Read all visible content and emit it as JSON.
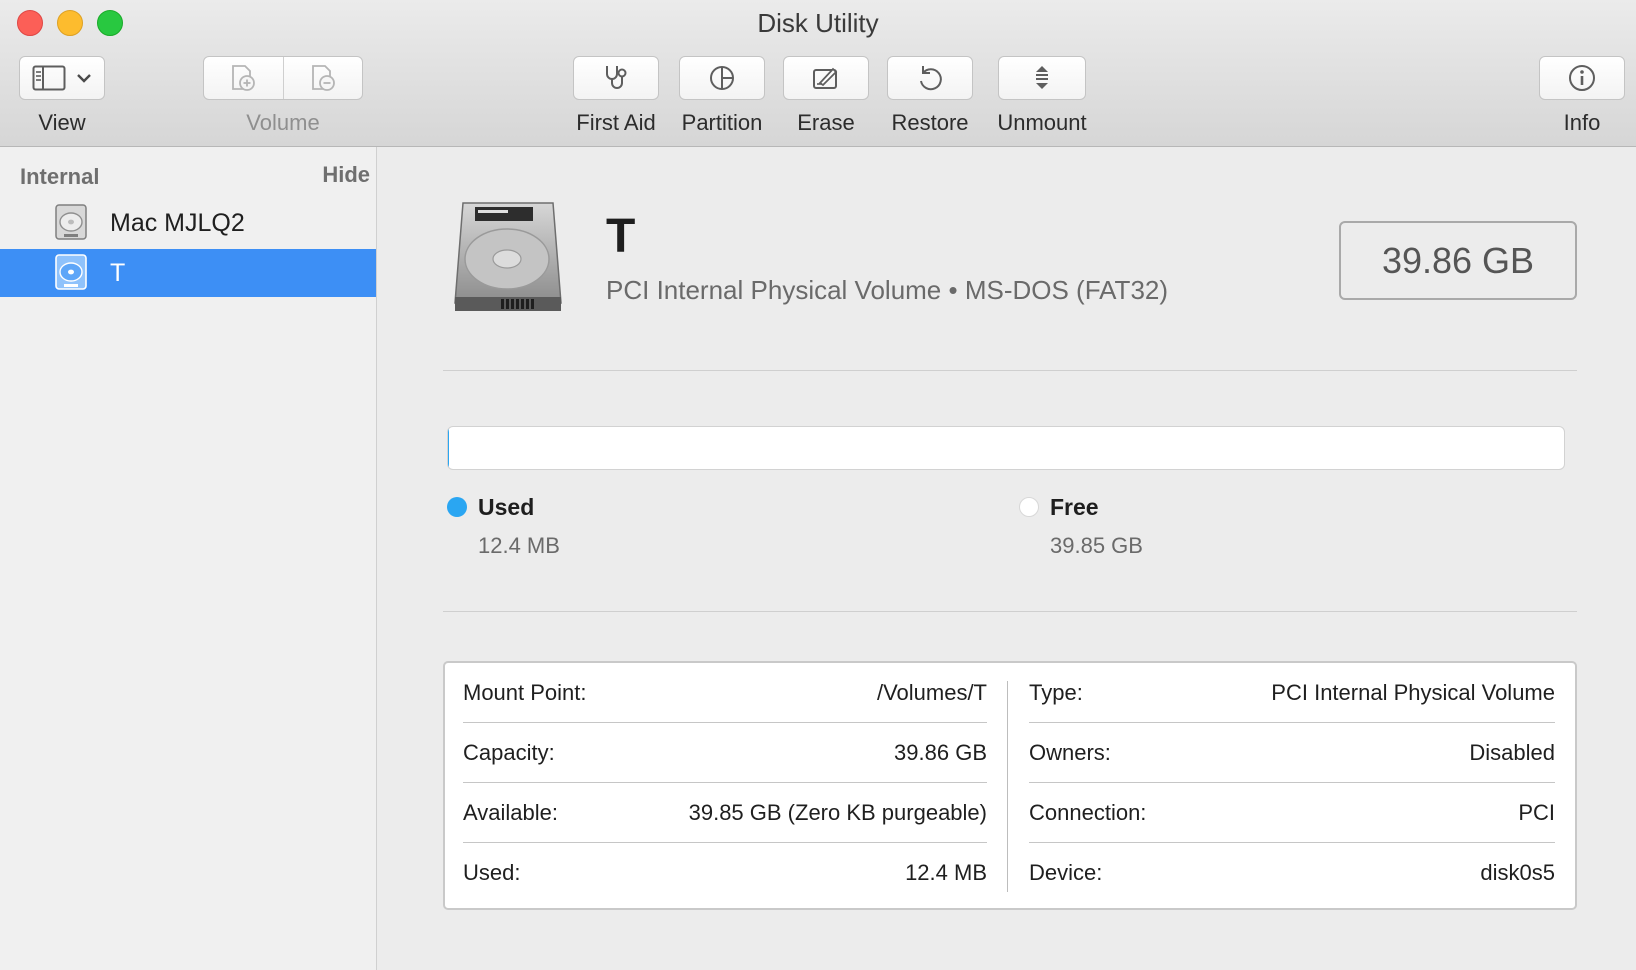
{
  "window": {
    "title": "Disk Utility"
  },
  "toolbar": {
    "view": {
      "label": "View",
      "icon": "sidebar-icon"
    },
    "volume": {
      "label": "Volume",
      "add_icon": "add-volume-icon",
      "remove_icon": "remove-volume-icon",
      "enabled": false
    },
    "first_aid": {
      "label": "First Aid",
      "icon": "stethoscope-icon"
    },
    "partition": {
      "label": "Partition",
      "icon": "pie-chart-icon"
    },
    "erase": {
      "label": "Erase",
      "icon": "erase-icon"
    },
    "restore": {
      "label": "Restore",
      "icon": "restore-icon"
    },
    "unmount": {
      "label": "Unmount",
      "icon": "unmount-icon"
    },
    "info": {
      "label": "Info",
      "icon": "info-icon"
    }
  },
  "sidebar": {
    "section_title": "Internal",
    "hide_label": "Hide",
    "items": [
      {
        "label": "Mac MJLQ2",
        "icon": "hard-disk-icon",
        "selected": false
      },
      {
        "label": "T",
        "icon": "volume-icon",
        "selected": true
      }
    ]
  },
  "volume": {
    "name": "T",
    "subtitle": "PCI Internal Physical Volume • MS-DOS (FAT32)",
    "size": "39.86 GB"
  },
  "usage": {
    "used_fraction": 0.0003,
    "used_color": "#2aa6f2",
    "free_color": "#ffffff",
    "used_title": "Used",
    "used_value": "12.4 MB",
    "free_title": "Free",
    "free_value": "39.85 GB"
  },
  "details": {
    "left": [
      {
        "key": "Mount Point:",
        "value": "/Volumes/T"
      },
      {
        "key": "Capacity:",
        "value": "39.86 GB"
      },
      {
        "key": "Available:",
        "value": "39.85 GB (Zero KB purgeable)"
      },
      {
        "key": "Used:",
        "value": "12.4 MB"
      }
    ],
    "right": [
      {
        "key": "Type:",
        "value": "PCI Internal Physical Volume"
      },
      {
        "key": "Owners:",
        "value": "Disabled"
      },
      {
        "key": "Connection:",
        "value": "PCI"
      },
      {
        "key": "Device:",
        "value": "disk0s5"
      }
    ]
  }
}
